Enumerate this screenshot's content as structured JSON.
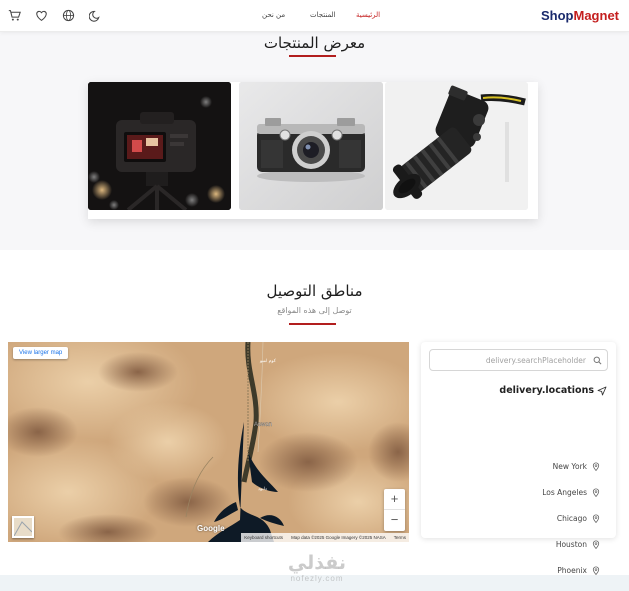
{
  "header": {
    "logo_part1": "Shop",
    "logo_part2": "Magnet",
    "nav": {
      "home": "الرئيسية",
      "products": "المنتجات",
      "about": "من نحن"
    },
    "icons": [
      "cart-icon",
      "heart-icon",
      "globe-icon",
      "moon-icon"
    ]
  },
  "gallery": {
    "title": "معرض المنتجات",
    "images": [
      "dslr-camera-strap",
      "vintage-film-camera",
      "camera-on-tripod-night"
    ]
  },
  "delivery": {
    "title": "مناطق التوصيل",
    "subtitle": "توصل إلى هذه المواقع",
    "search_placeholder": "delivery.searchPlaceholder",
    "locations_title": "delivery.locations",
    "locations": [
      "New York",
      "Los Angeles",
      "Chicago",
      "Houston",
      "Phoenix"
    ]
  },
  "map": {
    "larger_map_label": "View larger map",
    "zoom_in": "+",
    "zoom_out": "−",
    "google": "Google",
    "attribution": {
      "shortcuts": "Keyboard shortcuts",
      "data": "Map data ©2025 Google Imagery ©2025 NASA",
      "terms": "Terms"
    },
    "place_label": "Aswan"
  },
  "colors": {
    "accent": "#c41e1e",
    "brand": "#1a2a6c"
  },
  "watermark": {
    "ar": "نفذلي",
    "en": "nofezly.com"
  }
}
